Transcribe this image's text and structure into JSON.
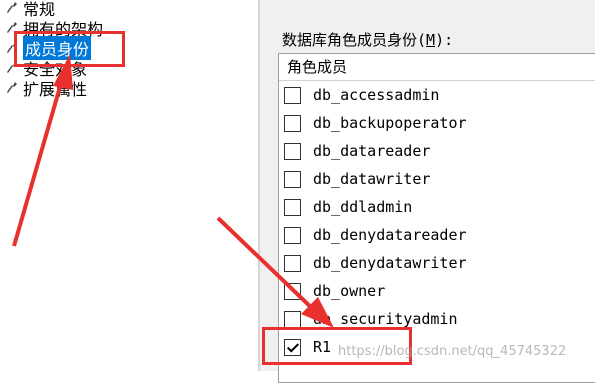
{
  "left_nav": {
    "items": [
      {
        "label": "常规",
        "icon": "wrench-icon",
        "selected": false
      },
      {
        "label": "拥有的架构",
        "icon": "wrench-icon",
        "selected": false
      },
      {
        "label": "成员身份",
        "icon": "wrench-icon",
        "selected": true
      },
      {
        "label": "安全对象",
        "icon": "wrench-icon",
        "selected": false
      },
      {
        "label": "扩展属性",
        "icon": "wrench-icon",
        "selected": false
      }
    ]
  },
  "right_panel": {
    "section_label": {
      "before": "数据库角色成员身份(",
      "mnemonic": "M",
      "after": "):"
    },
    "list_header": "角色成员",
    "roles": [
      {
        "name": "db_accessadmin",
        "checked": false
      },
      {
        "name": "db_backupoperator",
        "checked": false
      },
      {
        "name": "db_datareader",
        "checked": false
      },
      {
        "name": "db_datawriter",
        "checked": false
      },
      {
        "name": "db_ddladmin",
        "checked": false
      },
      {
        "name": "db_denydatareader",
        "checked": false
      },
      {
        "name": "db_denydatawriter",
        "checked": false
      },
      {
        "name": "db_owner",
        "checked": false
      },
      {
        "name": "db_securityadmin",
        "checked": false
      },
      {
        "name": "R1",
        "checked": true
      }
    ]
  },
  "annotations": {
    "color": "#e8312f"
  },
  "watermark": "https://blog.csdn.net/qq_45745322",
  "colors": {
    "selection": "#0078d7",
    "panel_bg": "#f0f0f0"
  }
}
